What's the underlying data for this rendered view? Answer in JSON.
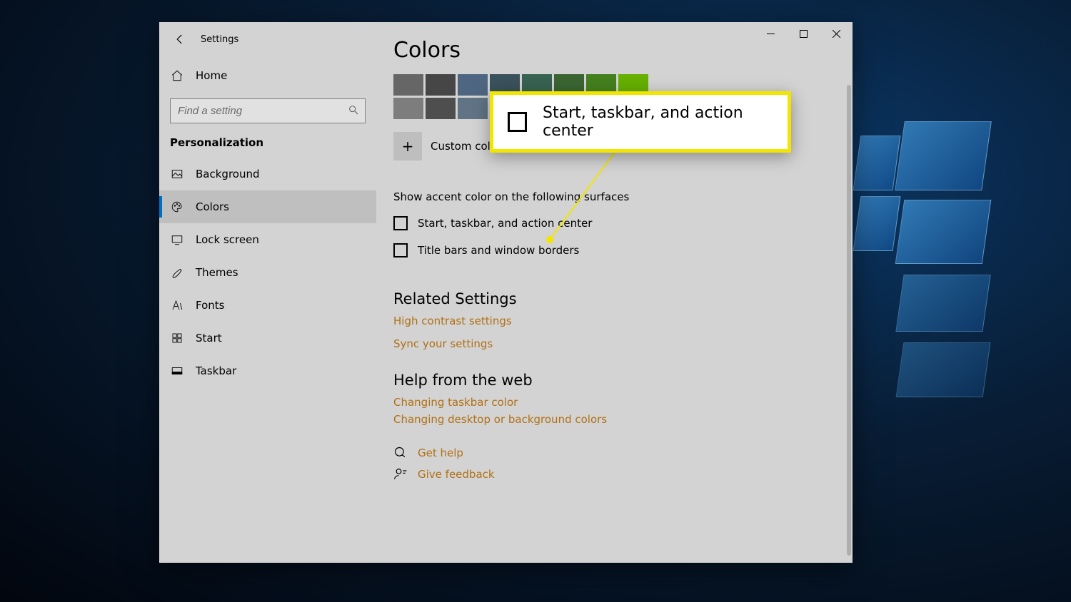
{
  "window": {
    "title": "Settings"
  },
  "sidebar": {
    "home": "Home",
    "search_placeholder": "Find a setting",
    "section": "Personalization",
    "items": [
      {
        "label": "Background"
      },
      {
        "label": "Colors"
      },
      {
        "label": "Lock screen"
      },
      {
        "label": "Themes"
      },
      {
        "label": "Fonts"
      },
      {
        "label": "Start"
      },
      {
        "label": "Taskbar"
      }
    ]
  },
  "main": {
    "title": "Colors",
    "custom_color": "Custom color",
    "accent_heading": "Show accent color on the following surfaces",
    "checks": {
      "start": "Start, taskbar, and action center",
      "title_bars": "Title bars and window borders"
    },
    "related_heading": "Related Settings",
    "related_links": {
      "high_contrast": "High contrast settings",
      "sync": "Sync your settings"
    },
    "help_heading": "Help from the web",
    "help_links": {
      "taskbar_color": "Changing taskbar color",
      "desktop_color": "Changing desktop or background colors"
    },
    "footer": {
      "get_help": "Get help",
      "feedback": "Give feedback"
    }
  },
  "callout": {
    "label": "Start, taskbar, and action center"
  }
}
